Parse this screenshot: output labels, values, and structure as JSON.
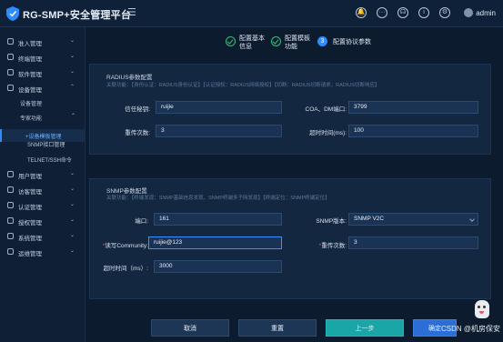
{
  "app": {
    "title": "RG-SMP+安全管理平台",
    "menu_glyph": "☰",
    "user": "admin"
  },
  "top_icons": [
    {
      "name": "notification-bell-icon",
      "glyph": "🔔"
    },
    {
      "name": "more-icon",
      "glyph": "···"
    },
    {
      "name": "headset-icon",
      "glyph": "☊"
    },
    {
      "name": "info-icon",
      "glyph": "i"
    },
    {
      "name": "settings-icon",
      "glyph": "⚙"
    }
  ],
  "sidebar": {
    "items": [
      {
        "label": "准入管理",
        "arrow": "⌄"
      },
      {
        "label": "终端管理",
        "arrow": "⌄"
      },
      {
        "label": "软件管理",
        "arrow": "⌄"
      },
      {
        "label": "设备管理",
        "arrow": "⌃"
      },
      {
        "label": "用户管理",
        "arrow": "⌄"
      },
      {
        "label": "访客管理",
        "arrow": "⌄"
      },
      {
        "label": "认证管理",
        "arrow": "⌄"
      },
      {
        "label": "授权管理",
        "arrow": "⌄"
      },
      {
        "label": "系统管理",
        "arrow": "⌄"
      },
      {
        "label": "运维管理",
        "arrow": "⌄"
      }
    ],
    "sub": {
      "device_manage": "设备管理",
      "expert": "专家功能",
      "expert_arrow": "⌃",
      "active": "+设备模板管理",
      "snmp": "SNMP接口管理",
      "telnet": "TELNET/SSH命令"
    }
  },
  "steps": [
    {
      "label": "配置基本\n信息",
      "state": "done"
    },
    {
      "label": "配置模板\n功能",
      "state": "done"
    },
    {
      "num": "3",
      "label": "配置协议参数",
      "state": "current"
    }
  ],
  "radius": {
    "title": "RADIUS参数配置",
    "desc": "关联功能：【身份认证：RADIUS身份认证】【认证授权：RADIUS网络授权】【切断：RADIUS切断请求，RADIUS切断响应】",
    "secret_label": "信任秘钥:",
    "secret_value": "ruijie",
    "coa_label": "COA、DM端口:",
    "coa_value": "3799",
    "retry_label": "重传次数:",
    "retry_value": "3",
    "timeout_label": "超时时间(ms):",
    "timeout_value": "100"
  },
  "snmp": {
    "title": "SNMP参数配置",
    "desc": "关联功能：【终端发现：SNMP基础信息发现、SNMP终端多子网发现】【终端定位：SNMP终端定位】",
    "port_label": "端口:",
    "port_value": "161",
    "version_label": "SNMP版本:",
    "version_value": "SNMP V2C",
    "rw_label": "读写Community:",
    "rw_value": "ruijie@123",
    "retry_label": "重传次数:",
    "retry_value": "3",
    "timeout_label": "超时时间（ms）:",
    "timeout_value": "3000"
  },
  "footer": {
    "cancel": "取消",
    "reset": "重置",
    "prev": "上一步",
    "save": "确定"
  },
  "watermark": "CSDN @机房保安",
  "colors": {
    "accent": "#2f8cff",
    "success": "#34c27c",
    "teal": "#1aa6a6"
  }
}
